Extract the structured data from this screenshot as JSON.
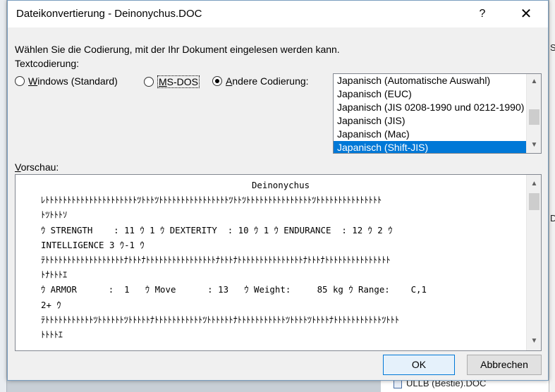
{
  "dialog": {
    "title": "Dateikonvertierung - Deinonychus.DOC",
    "help_label": "?",
    "close_label": "✕"
  },
  "instruction": "Wählen Sie die Codierung, mit der Ihr Dokument eingelesen werden kann.",
  "text_encoding_label": "Textcodierung:",
  "radios": {
    "windows": {
      "mnemonic": "W",
      "rest": "indows (Standard)",
      "checked": false
    },
    "msdos": {
      "mnemonic": "M",
      "rest": "S-DOS",
      "checked": false
    },
    "other": {
      "mnemonic": "A",
      "rest": "ndere Codierung:",
      "checked": true
    }
  },
  "encoding_list": {
    "items": [
      "Japanisch (Automatische Auswahl)",
      "Japanisch (EUC)",
      "Japanisch (JIS 0208-1990 und 0212-1990)",
      "Japanisch (JIS)",
      "Japanisch (Mac)",
      "Japanisch (Shift-JIS)"
    ],
    "selected_index": 5
  },
  "preview_label": {
    "mnemonic": "V",
    "rest": "orschau:"
  },
  "preview_lines": [
    "Deinonychus",
    "ﾚﾄﾄﾄﾄﾄﾄﾄﾄﾄﾄﾄﾄﾄﾄﾄﾄﾄﾄﾄﾄﾄﾂﾄﾄﾄﾂﾄﾄﾄﾄﾄﾄﾄﾄﾄﾄﾄﾄﾄﾄﾄﾄﾂﾄﾄﾂﾄﾄﾄﾄﾄﾄﾄﾄﾄﾄﾄﾄﾄﾄﾄﾂﾄﾄﾄﾄﾄﾄﾄﾄﾄﾄﾄﾄﾄﾄﾄ",
    "ﾄﾂﾄﾄﾄｿ",
    "ｳ STRENGTH    : 11 ｳ 1 ｳ DEXTERITY  : 10 ｳ 1 ｳ ENDURANCE  : 12 ｳ 2 ｳ",
    "INTELLIGENCE 3 ｳ-1 ｳ",
    "ﾃﾄﾄﾄﾄﾄﾄﾄﾄﾄﾄﾄﾄﾄﾄﾄﾄﾄﾄﾅﾄﾄﾄﾅﾄﾄﾄﾄﾄﾄﾄﾄﾄﾄﾄﾄﾄﾄﾄﾄﾅﾄﾄﾄﾅﾄﾄﾄﾄﾄﾄﾄﾄﾄﾄﾄﾄﾄﾄﾄﾅﾄﾄﾄﾅﾄﾄﾄﾄﾄﾄﾄﾄﾄﾄﾄﾄﾄﾄﾄ",
    "ﾄﾅﾄﾄﾄｴ",
    "ｳ ARMOR      :  1   ｳ Move      : 13   ｳ Weight:     85 kg ｳ Range:    C,1",
    "2+ ｳ",
    "ﾃﾄﾄﾄﾄﾄﾄﾄﾄﾄﾄﾄﾂﾄﾄﾄﾄﾄﾄﾂﾄﾄﾄﾄﾄﾅﾄﾄﾄﾄﾄﾄﾄﾄﾄﾄﾄﾂﾄﾄﾄﾄﾄﾄﾅﾄﾄﾄﾄﾄﾄﾄﾄﾄﾄﾄﾂﾄﾄﾄﾄﾂﾄﾄﾄﾄﾅﾄﾄﾄﾄﾄﾄﾄﾄﾄﾄﾄﾂﾄﾄﾄ",
    "ﾄﾄﾄﾄｴ"
  ],
  "buttons": {
    "ok": "OK",
    "cancel": "Abbrechen"
  },
  "background": {
    "right_fragment_1": "S",
    "right_fragment_2": "D",
    "file_name": "ULLB (Bestie).DOC"
  },
  "colors": {
    "selection": "#0078d7",
    "ok_border": "#0078d7"
  }
}
